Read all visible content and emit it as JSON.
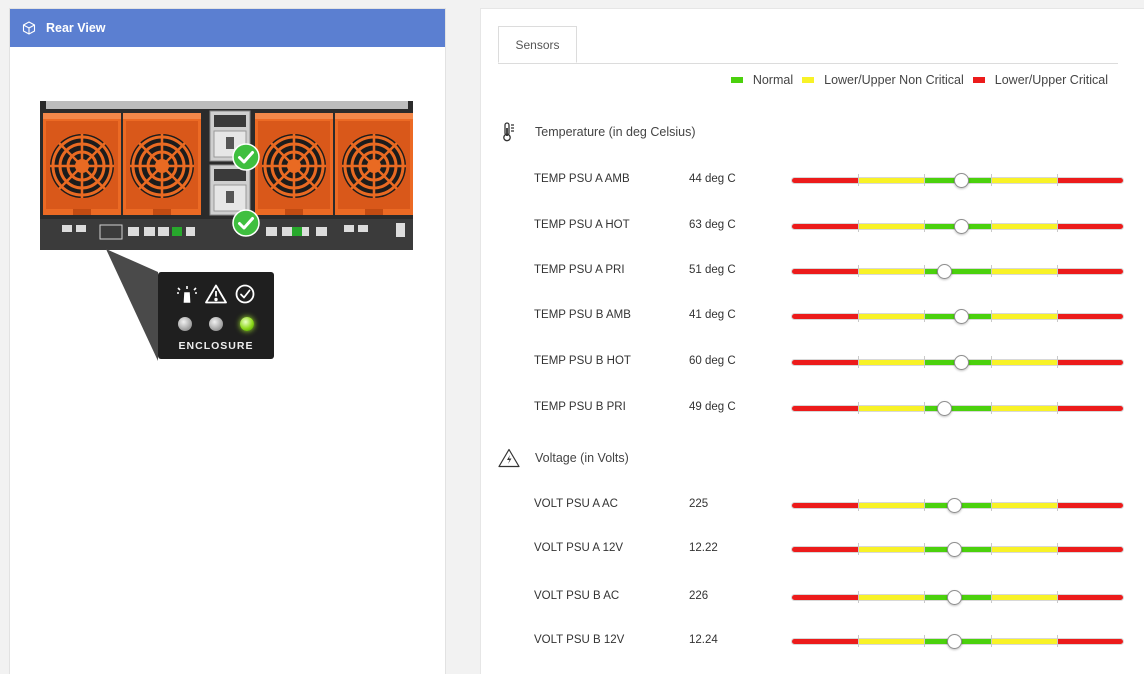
{
  "colors": {
    "header_bg": "#5b7fd1",
    "normal": "#4bd10d",
    "non_critical": "#f8f227",
    "critical": "#ec1b1b",
    "chassis_orange": "#ec6a24"
  },
  "rear_view": {
    "title": "Rear View",
    "header_icon": "cube-icon",
    "enclosure_label": "ENCLOSURE",
    "led_icons": [
      "locator-beacon-icon",
      "warning-icon",
      "check-circle-icon"
    ],
    "leds": [
      {
        "name": "locator",
        "state": "off"
      },
      {
        "name": "fault",
        "state": "off"
      },
      {
        "name": "health",
        "state": "on-green"
      }
    ],
    "psu_status": [
      "ok",
      "ok"
    ]
  },
  "tabs": [
    {
      "label": "Sensors",
      "active": true
    }
  ],
  "legend": [
    {
      "label": "Normal",
      "color": "#4bd10d"
    },
    {
      "label": "Lower/Upper Non Critical",
      "color": "#f8f227"
    },
    {
      "label": "Lower/Upper Critical",
      "color": "#ec1b1b"
    }
  ],
  "temperature": {
    "title": "Temperature (in deg Celsius)",
    "icon": "thermometer-icon",
    "sensors": [
      {
        "name": "TEMP PSU A AMB",
        "value": "44 deg C",
        "level": 0.51
      },
      {
        "name": "TEMP PSU A HOT",
        "value": "63 deg C",
        "level": 0.51
      },
      {
        "name": "TEMP PSU A PRI",
        "value": "51 deg C",
        "level": 0.46
      },
      {
        "name": "TEMP PSU B AMB",
        "value": "41 deg C",
        "level": 0.51
      },
      {
        "name": "TEMP PSU B HOT",
        "value": "60 deg C",
        "level": 0.51
      },
      {
        "name": "TEMP PSU B PRI",
        "value": "49 deg C",
        "level": 0.46
      }
    ]
  },
  "voltage": {
    "title": "Voltage (in Volts)",
    "icon": "voltage-warning-icon",
    "sensors": [
      {
        "name": "VOLT PSU A AC",
        "value": "225",
        "level": 0.49
      },
      {
        "name": "VOLT PSU A 12V",
        "value": "12.22",
        "level": 0.49
      },
      {
        "name": "VOLT PSU B AC",
        "value": "226",
        "level": 0.49
      },
      {
        "name": "VOLT PSU B 12V",
        "value": "12.24",
        "level": 0.49
      }
    ]
  }
}
